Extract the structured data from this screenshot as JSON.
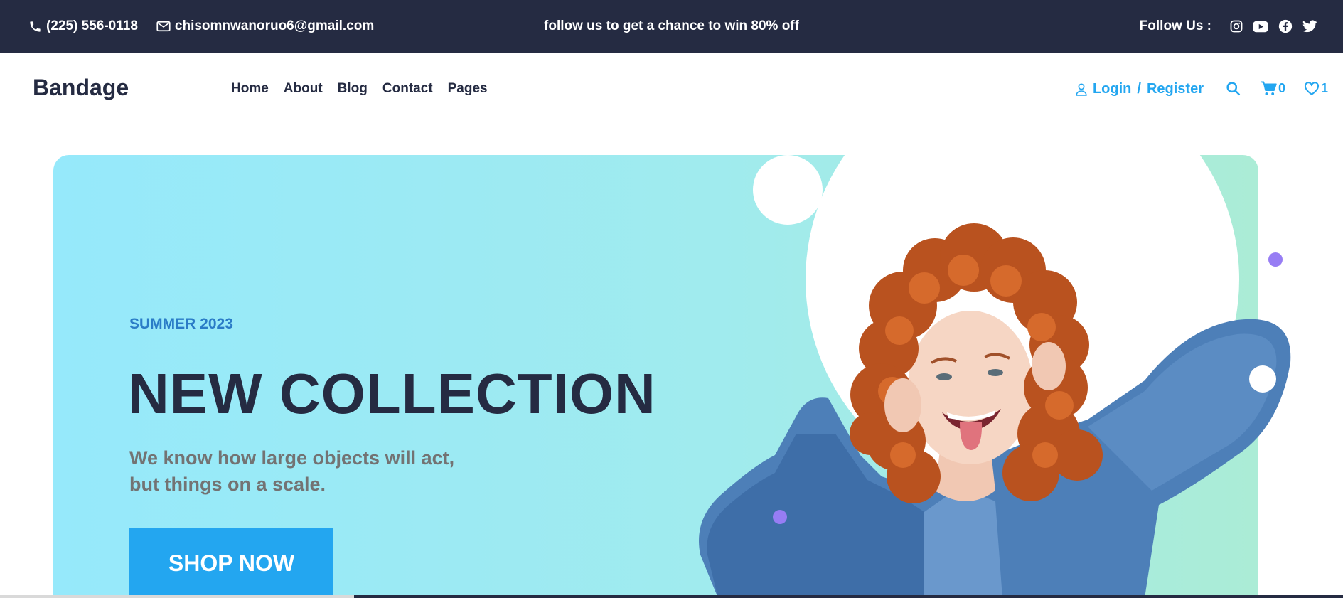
{
  "topbar": {
    "phone": "(225) 556-0118",
    "email": "chisomnwanoruo6@gmail.com",
    "promo": "follow us to get a chance to win 80% off",
    "follow_label": "Follow Us :",
    "social_icons": [
      "instagram-icon",
      "youtube-icon",
      "facebook-icon",
      "twitter-icon"
    ],
    "background": "#252b42"
  },
  "nav": {
    "brand": "Bandage",
    "menu": [
      "Home",
      "About",
      "Blog",
      "Contact",
      "Pages"
    ],
    "login": "Login",
    "separator": "/",
    "register": "Register",
    "cart_count": "0",
    "wishlist_count": "1",
    "accent": "#23a6f0"
  },
  "hero": {
    "season": "SUMMER 2023",
    "headline": "NEW COLLECTION",
    "description": "We know how large objects will act, but things on a scale.",
    "cta": "SHOP NOW",
    "cta_color": "#23a6f0",
    "gradient": [
      "#96e9fb",
      "#abecd6"
    ]
  }
}
